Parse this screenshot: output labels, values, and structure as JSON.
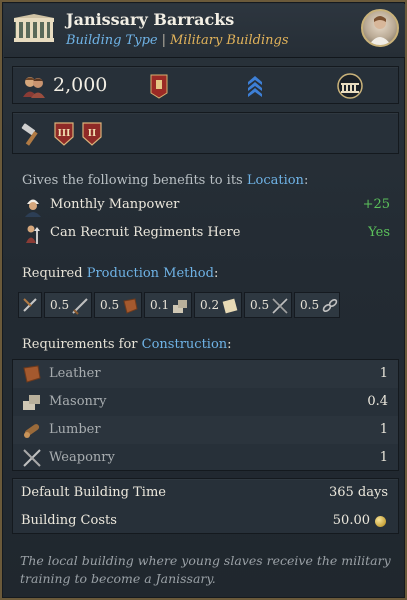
{
  "header": {
    "title": "Janissary Barracks",
    "type_link": "Building Type",
    "separator": "|",
    "category": "Military Buildings"
  },
  "stats": {
    "manpower": "2,000",
    "icons": [
      "manpower-icon",
      "regiment-banner-icon",
      "rank-chevrons-icon",
      "building-arches-icon"
    ]
  },
  "tools": {
    "icons": [
      "hammer-icon",
      "level-iii-badge-icon",
      "level-ii-badge-icon"
    ],
    "badge_iii": "III",
    "badge_ii": "II"
  },
  "benefits": {
    "heading_prefix": "Gives the following benefits to its ",
    "heading_link": "Location",
    "heading_suffix": ":",
    "items": [
      {
        "label": "Monthly Manpower",
        "value": "+25",
        "icon": "soldier-portrait-icon"
      },
      {
        "label": "Can Recruit Regiments Here",
        "value": "Yes",
        "icon": "recruit-icon"
      }
    ]
  },
  "production": {
    "heading_prefix": "Required ",
    "heading_link": "Production Method",
    "heading_suffix": ":",
    "inputs": [
      {
        "amount": "0.5",
        "icon": "weaponry-icon"
      },
      {
        "amount": "0.5",
        "icon": "leather-icon"
      },
      {
        "amount": "0.1",
        "icon": "masonry-icon"
      },
      {
        "amount": "0.2",
        "icon": "paper-icon"
      },
      {
        "amount": "0.5",
        "icon": "crossed-swords-icon"
      },
      {
        "amount": "0.5",
        "icon": "chain-icon"
      }
    ]
  },
  "construction": {
    "heading_prefix": "Requirements for ",
    "heading_link": "Construction",
    "heading_suffix": ":",
    "items": [
      {
        "label": "Leather",
        "value": "1",
        "icon": "leather-icon"
      },
      {
        "label": "Masonry",
        "value": "0.4",
        "icon": "masonry-icon"
      },
      {
        "label": "Lumber",
        "value": "1",
        "icon": "lumber-icon"
      },
      {
        "label": "Weaponry",
        "value": "1",
        "icon": "weaponry-icon"
      }
    ]
  },
  "totals": {
    "time_label": "Default Building Time",
    "time_value": "365 days",
    "cost_label": "Building Costs",
    "cost_value": "50.00"
  },
  "description": "The local building where young slaves receive the military training to become a Janissary.",
  "colors": {
    "link": "#6fb3e6",
    "category": "#e0b25a",
    "positive": "#5bc15b",
    "gold": "#c8a33a"
  }
}
